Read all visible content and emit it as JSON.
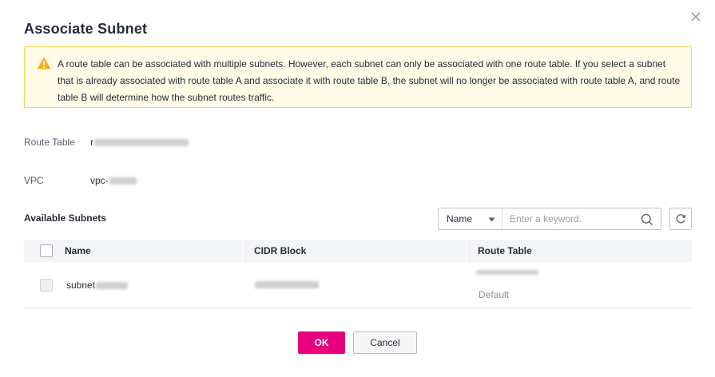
{
  "dialog": {
    "title": "Associate Subnet",
    "alert_text": "A route table can be associated with multiple subnets. However, each subnet can only be associated with one route table. If you select a subnet that is already associated with route table A and associate it with route table B, the subnet will no longer be associated with route table A, and route table B will determine how the subnet routes traffic.",
    "close_icon": "close-icon",
    "warning_icon": "warning-triangle-icon",
    "warning_color": "#faad14"
  },
  "info": {
    "route_table_label": "Route Table",
    "route_table_value_prefix": "r",
    "vpc_label": "VPC",
    "vpc_value_prefix": "vpc-"
  },
  "subnets": {
    "section_title": "Available Subnets",
    "filter_field": "Name",
    "search_placeholder": "Enter a keyword.",
    "columns": [
      "Name",
      "CIDR Block",
      "Route Table"
    ],
    "rows": [
      {
        "name_prefix": "subnet",
        "route_table_sub": "Default",
        "disabled": true
      }
    ]
  },
  "footer": {
    "ok_label": "OK",
    "cancel_label": "Cancel",
    "ok_color": "#e6007e"
  }
}
